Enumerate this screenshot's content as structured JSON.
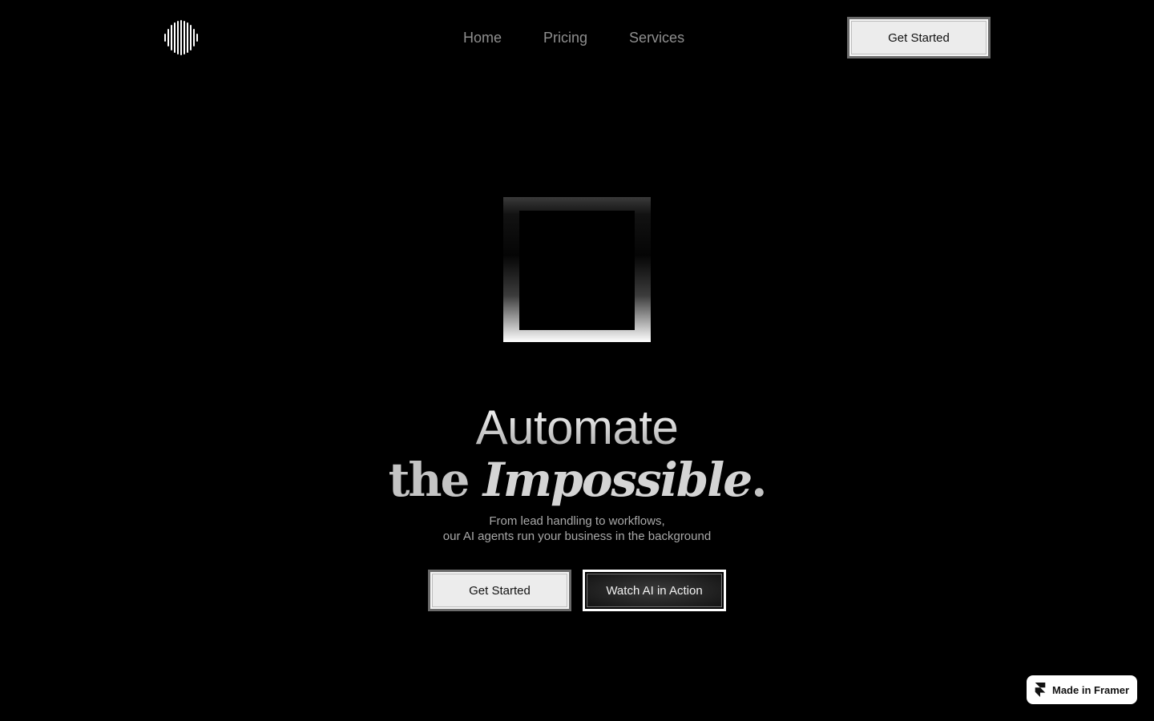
{
  "header": {
    "logo_icon": "soundwave-logo-icon",
    "nav": [
      {
        "label": "Home"
      },
      {
        "label": "Pricing"
      },
      {
        "label": "Services"
      }
    ],
    "cta_label": "Get Started"
  },
  "hero": {
    "headline_line1": "Automate",
    "headline_the": "the",
    "headline_impossible": "Impossible",
    "headline_period": ".",
    "sub_line1": "From lead handling to workflows,",
    "sub_line2": "our AI agents run your business in the background",
    "primary_cta": "Get Started",
    "secondary_cta": "Watch AI in Action"
  },
  "badge": {
    "icon": "framer-logo-icon",
    "label": "Made in Framer"
  },
  "colors": {
    "background": "#000000",
    "nav_text": "#8f8f8f",
    "button_light": "#ececec"
  }
}
